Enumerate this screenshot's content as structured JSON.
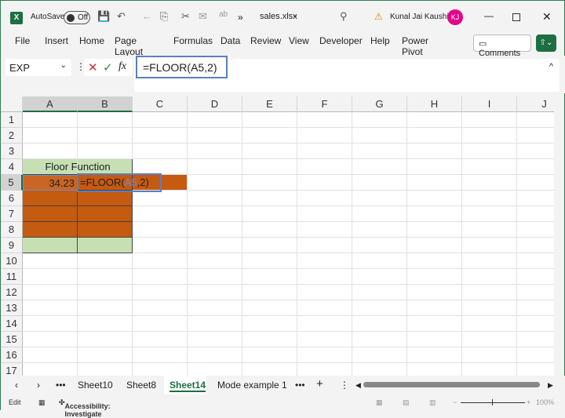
{
  "titlebar": {
    "autosave": "AutoSave",
    "toggle": "Off",
    "filename": "sales.xlsx",
    "user": "Kunal Jai Kaushik",
    "initials": "KJ",
    "more": "»"
  },
  "menu": [
    "File",
    "Insert",
    "Home",
    "Page Layout",
    "Formulas",
    "Data",
    "Review",
    "View",
    "Developer",
    "Help",
    "Power Pivot"
  ],
  "comments": "Comments",
  "namebox": "EXP",
  "formula": "=FLOOR(A5,2)",
  "columns": [
    "A",
    "B",
    "C",
    "D",
    "E",
    "F",
    "G",
    "H",
    "I",
    "J"
  ],
  "rows": [
    "1",
    "2",
    "3",
    "4",
    "5",
    "6",
    "7",
    "8",
    "9",
    "10",
    "11",
    "12",
    "13",
    "14",
    "15",
    "16",
    "17"
  ],
  "cells": {
    "A4": "Floor Function",
    "A5": "34.23",
    "B5_pre": "=FLOOR(",
    "B5_ref": "A5",
    "B5_post": ",2)"
  },
  "colors": {
    "green": "#c6e0b4",
    "orange": "#c55a11",
    "accent": "#1d6f42",
    "ref": "#7a86c8"
  },
  "sheets": [
    "Sheet10",
    "Sheet8",
    "Sheet14",
    "Mode example 1"
  ],
  "active_sheet": "Sheet14",
  "status": {
    "mode": "Edit",
    "accessibility": "Accessibility: Investigate",
    "zoom": "100%"
  }
}
